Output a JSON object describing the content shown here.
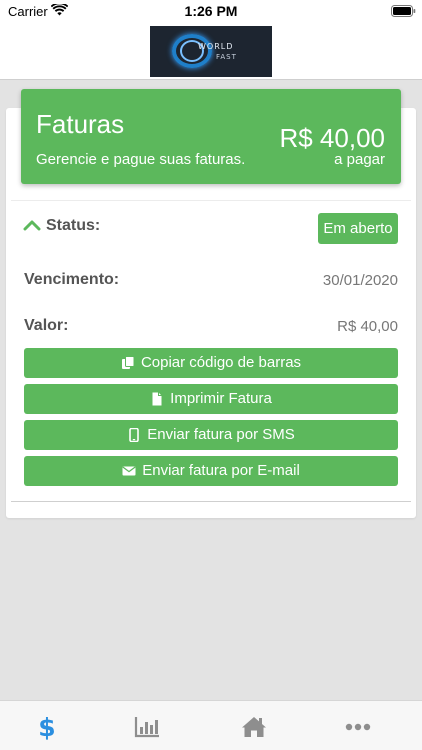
{
  "status_bar": {
    "carrier": "Carrier",
    "time": "1:26 PM"
  },
  "header": {
    "logo_line1": "WORLD",
    "logo_line2": "FAST"
  },
  "hero": {
    "title": "Faturas",
    "subtitle": "Gerencie e pague suas faturas.",
    "amount": "R$ 40,00",
    "amount_note": "a pagar"
  },
  "invoice": {
    "status_label": "Status:",
    "status_value": "Em aberto",
    "due_label": "Vencimento:",
    "due_value": "30/01/2020",
    "value_label": "Valor:",
    "value_value": "R$ 40,00",
    "buttons": {
      "copy": "Copiar código de barras",
      "print": "Imprimir Fatura",
      "sms": "Enviar fatura por SMS",
      "email": "Enviar fatura por E-mail"
    }
  },
  "tabbar": {
    "items": [
      {
        "icon": "dollar-icon",
        "label": "$",
        "active": true
      },
      {
        "icon": "bar-chart-icon",
        "active": false
      },
      {
        "icon": "home-icon",
        "active": false
      },
      {
        "icon": "more-icon",
        "active": false
      }
    ]
  },
  "colors": {
    "accent_green": "#5cb85c",
    "active_tab_blue": "#2b8fe0",
    "inactive_tab_gray": "#8e8e8e"
  }
}
